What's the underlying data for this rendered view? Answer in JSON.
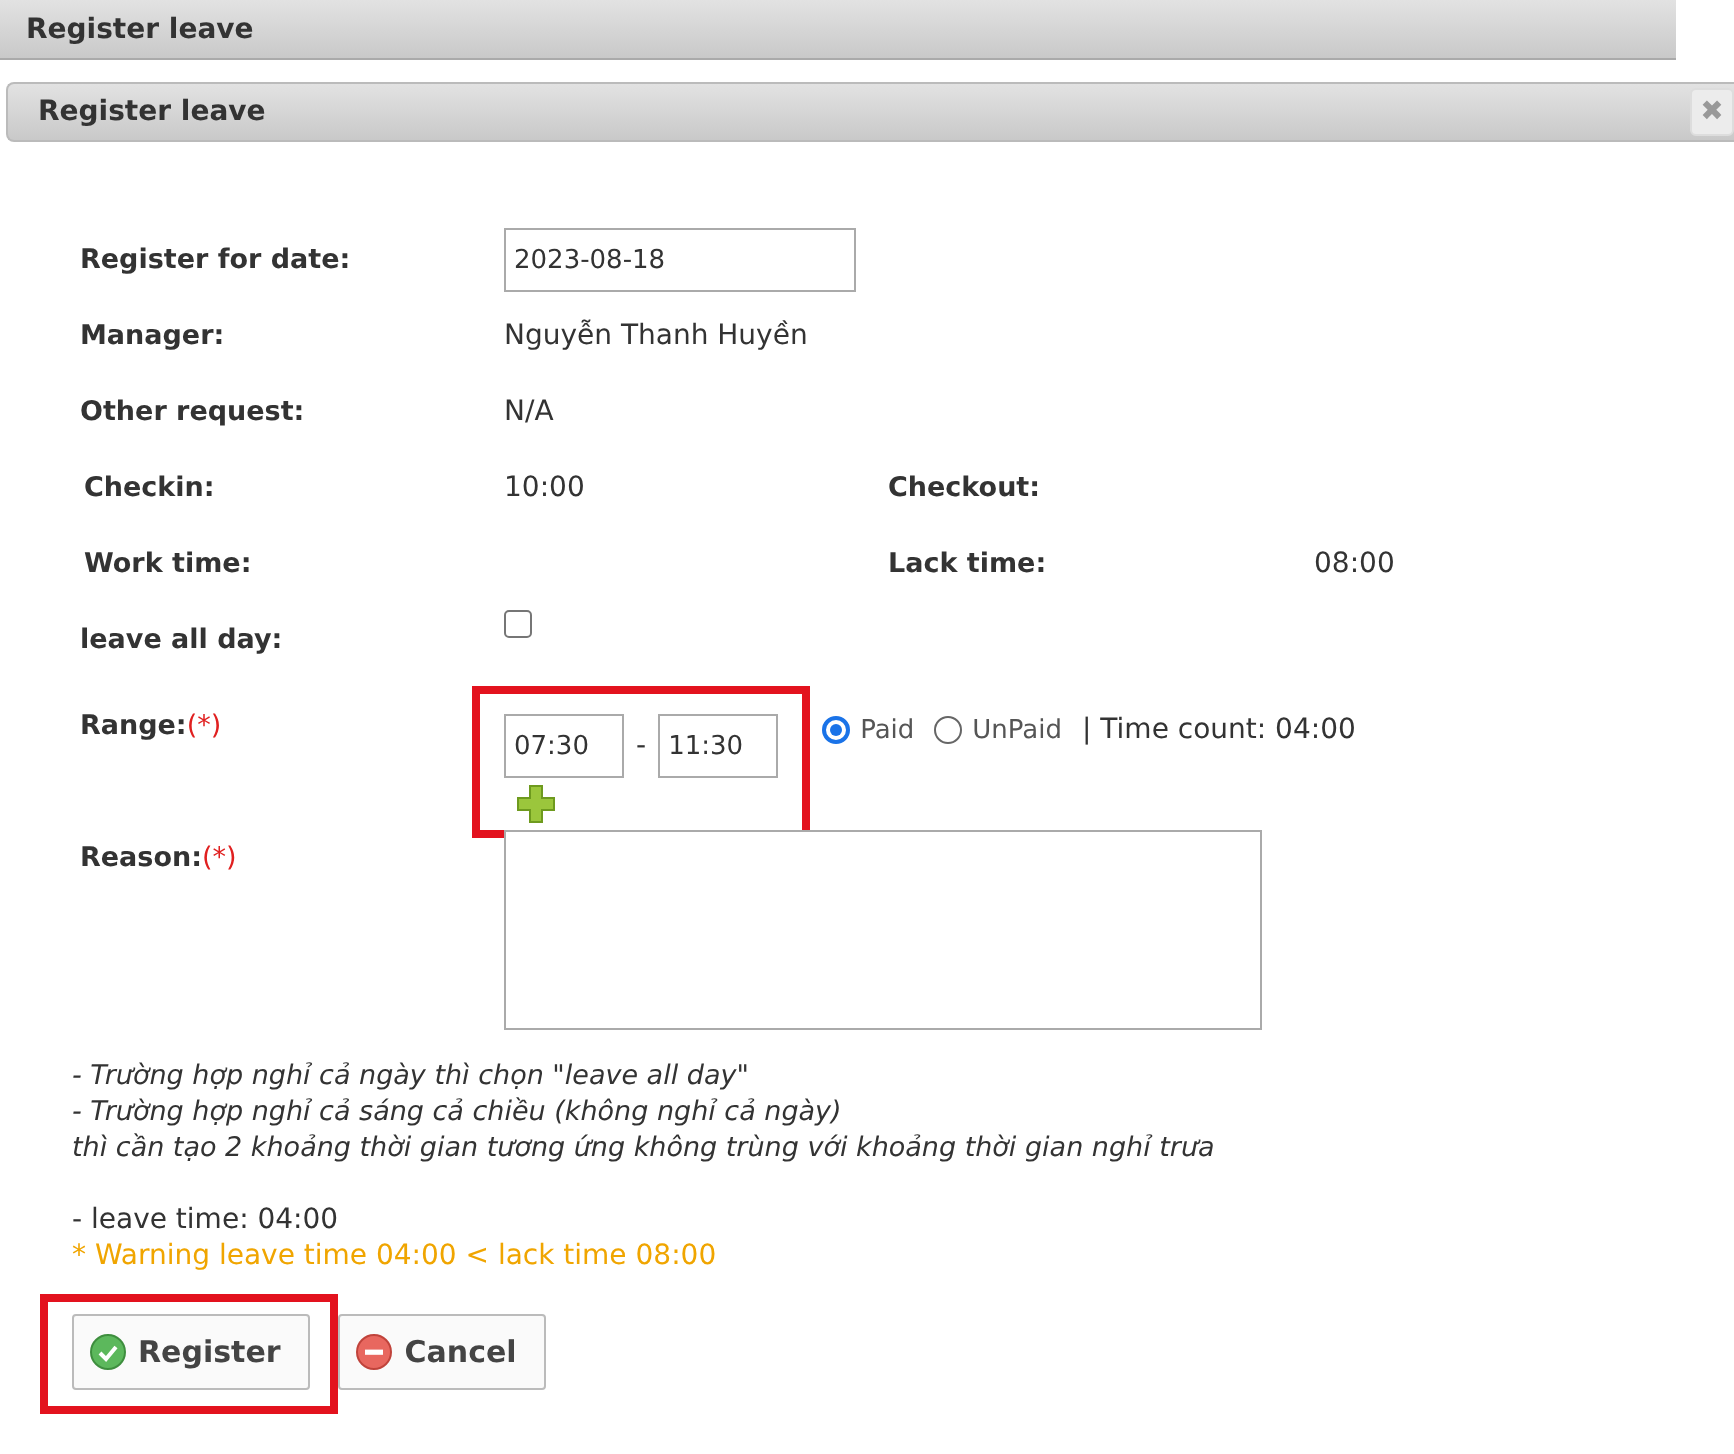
{
  "page_title": "Register leave",
  "dialog": {
    "title": "Register leave",
    "close": "✖"
  },
  "form": {
    "date": {
      "label": "Register for date:",
      "value": "2023-08-18"
    },
    "manager": {
      "label": "Manager:",
      "value": "Nguyễn Thanh Huyền"
    },
    "other_request": {
      "label": "Other request:",
      "value": "N/A"
    },
    "checkin": {
      "label": "Checkin:",
      "value": "10:00"
    },
    "checkout": {
      "label": "Checkout:"
    },
    "work_time": {
      "label": "Work time:"
    },
    "lack_time": {
      "label": "Lack time:",
      "value": "08:00"
    },
    "leave_all_day": {
      "label": "leave all day:",
      "checked": false
    },
    "range": {
      "label": "Range:",
      "required_mark": "(*)",
      "from": "07:30",
      "separator": "-",
      "to": "11:30",
      "highlighted": true,
      "pay_options": [
        {
          "label": "Paid",
          "selected": true
        },
        {
          "label": "UnPaid",
          "selected": false
        }
      ],
      "time_count": "| Time count: 04:00"
    },
    "reason": {
      "label": "Reason:",
      "required_mark": "(*)"
    }
  },
  "notes": [
    "- Trường hợp nghỉ cả ngày thì chọn \"leave all day\"",
    "- Trường hợp nghỉ cả sáng cả chiều (không nghỉ cả ngày)",
    "thì cần tạo 2 khoảng thời gian tương ứng không trùng với khoảng thời gian nghỉ trưa"
  ],
  "leave_time": "- leave time: 04:00",
  "warning": "* Warning leave time 04:00 < lack time 08:00",
  "buttons": [
    {
      "kind": "confirm",
      "label": "Register",
      "highlighted": true
    },
    {
      "kind": "cancel",
      "label": "Cancel",
      "highlighted": false
    }
  ]
}
